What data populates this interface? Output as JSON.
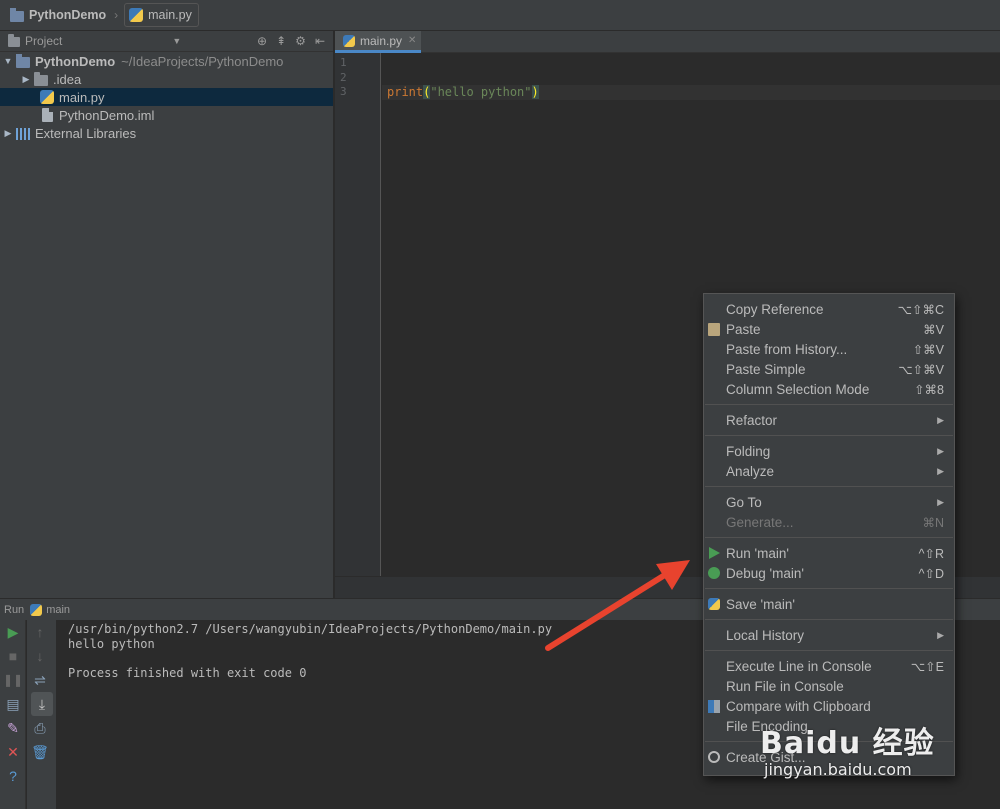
{
  "navbar": {
    "project": "PythonDemo",
    "file": "main.py"
  },
  "project_panel": {
    "title": "Project",
    "tree": {
      "root_name": "PythonDemo",
      "root_path": "~/IdeaProjects/PythonDemo",
      "items": [
        {
          "label": ".idea"
        },
        {
          "label": "main.py"
        },
        {
          "label": "PythonDemo.iml"
        },
        {
          "label": "External Libraries"
        }
      ]
    }
  },
  "editor": {
    "tab_label": "main.py",
    "line_numbers": [
      "1",
      "2",
      "3"
    ],
    "code": {
      "print_kw": "print",
      "open_paren": "(",
      "string": "\"hello python\"",
      "close_paren": ")"
    }
  },
  "run_panel": {
    "label": "Run",
    "config": "main",
    "console_lines": [
      "/usr/bin/python2.7 /Users/wangyubin/IdeaProjects/PythonDemo/main.py",
      "hello python",
      "",
      "Process finished with exit code 0"
    ]
  },
  "context_menu": {
    "items": [
      {
        "label": "Copy Reference",
        "shortcut": "⌥⇧⌘C"
      },
      {
        "label": "Paste",
        "shortcut": "⌘V"
      },
      {
        "label": "Paste from History...",
        "shortcut": "⇧⌘V"
      },
      {
        "label": "Paste Simple",
        "shortcut": "⌥⇧⌘V"
      },
      {
        "label": "Column Selection Mode",
        "shortcut": "⇧⌘8"
      },
      {
        "label": "Refactor"
      },
      {
        "label": "Folding"
      },
      {
        "label": "Analyze"
      },
      {
        "label": "Go To"
      },
      {
        "label": "Generate...",
        "shortcut": "⌘N"
      },
      {
        "label": "Run 'main'",
        "shortcut": "^⇧R"
      },
      {
        "label": "Debug 'main'",
        "shortcut": "^⇧D"
      },
      {
        "label": "Save 'main'"
      },
      {
        "label": "Local History"
      },
      {
        "label": "Execute Line in Console",
        "shortcut": "⌥⇧E"
      },
      {
        "label": "Run File in Console"
      },
      {
        "label": "Compare with Clipboard"
      },
      {
        "label": "File Encoding"
      },
      {
        "label": "Create Gist..."
      }
    ]
  },
  "watermark": {
    "logo": "Baidu 经验",
    "url": "jingyan.baidu.com"
  },
  "colors": {
    "annotation_arrow": "#e8432e",
    "selection": "#0d293e",
    "run_green": "#499c54"
  }
}
